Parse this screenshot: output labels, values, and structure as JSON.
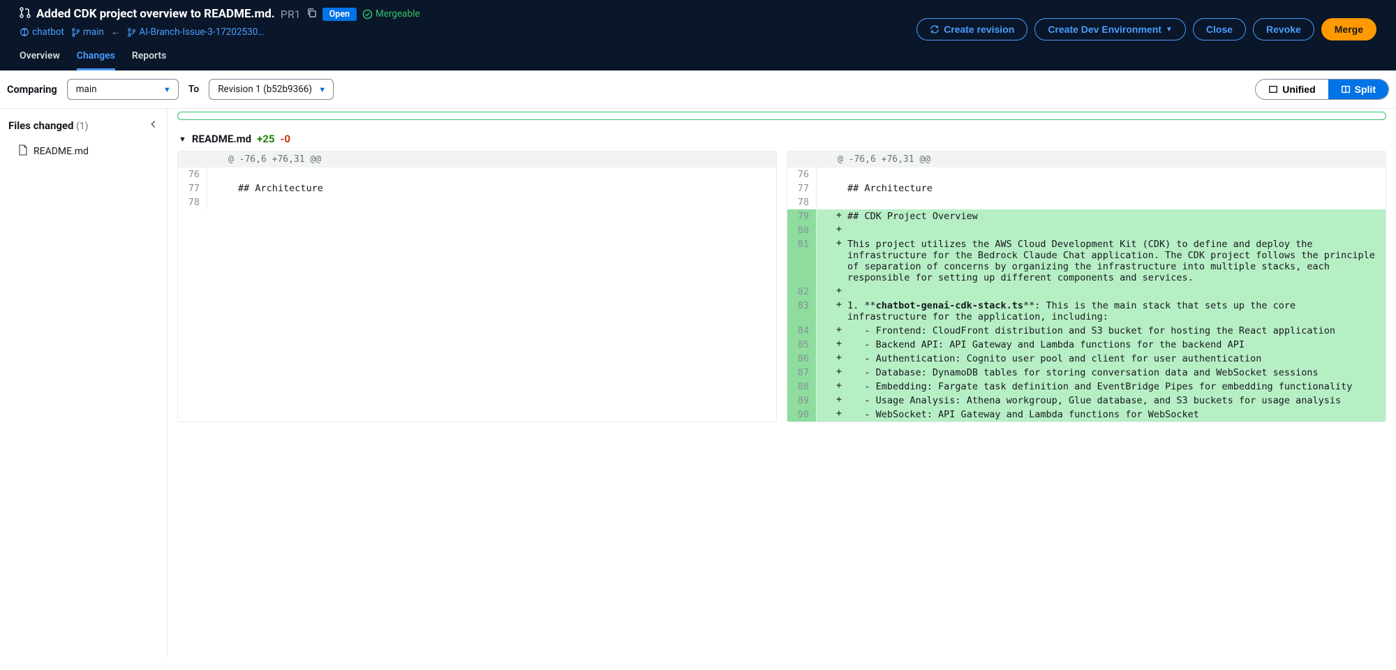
{
  "header": {
    "title": "Added CDK project overview to README.md.",
    "pr_number": "PR1",
    "status_badge": "Open",
    "mergeable_label": "Mergeable"
  },
  "breadcrumb": {
    "repo": "chatbot",
    "base_branch": "main",
    "source_branch": "AI-Branch-Issue-3-17202530…"
  },
  "actions": {
    "create_revision": "Create revision",
    "create_dev_env": "Create Dev Environment",
    "close": "Close",
    "revoke": "Revoke",
    "merge": "Merge"
  },
  "tabs": {
    "overview": "Overview",
    "changes": "Changes",
    "reports": "Reports"
  },
  "compare": {
    "label_comparing": "Comparing",
    "from_value": "main",
    "label_to": "To",
    "to_value": "Revision 1 (b52b9366)",
    "unified": "Unified",
    "split": "Split"
  },
  "sidebar": {
    "title": "Files changed",
    "count": "(1)",
    "file": "README.md"
  },
  "file_header": {
    "name": "README.md",
    "additions": "+25",
    "deletions": "-0"
  },
  "diff": {
    "hunk": "@ -76,6 +76,31 @@",
    "left_lines": [
      {
        "num": "76",
        "text": ""
      },
      {
        "num": "77",
        "text": "## Architecture"
      },
      {
        "num": "78",
        "text": ""
      }
    ],
    "right_context": [
      {
        "num": "76",
        "text": ""
      },
      {
        "num": "77",
        "text": "## Architecture"
      },
      {
        "num": "78",
        "text": ""
      }
    ],
    "right_added": [
      {
        "num": "79",
        "text": "## CDK Project Overview"
      },
      {
        "num": "80",
        "text": ""
      },
      {
        "num": "81",
        "text": "This project utilizes the AWS Cloud Development Kit (CDK) to define and deploy the infrastructure for the Bedrock Claude Chat application. The CDK project follows the principle of separation of concerns by organizing the infrastructure into multiple stacks, each responsible for setting up different components and services."
      },
      {
        "num": "82",
        "text": ""
      },
      {
        "num": "83",
        "bold_part": "chatbot-genai-cdk-stack.ts",
        "prefix": "1. **",
        "suffix": "**: This is the main stack that sets up the core infrastructure for the application, including:"
      },
      {
        "num": "84",
        "text": "   - Frontend: CloudFront distribution and S3 bucket for hosting the React application"
      },
      {
        "num": "85",
        "text": "   - Backend API: API Gateway and Lambda functions for the backend API"
      },
      {
        "num": "86",
        "text": "   - Authentication: Cognito user pool and client for user authentication"
      },
      {
        "num": "87",
        "text": "   - Database: DynamoDB tables for storing conversation data and WebSocket sessions"
      },
      {
        "num": "88",
        "text": "   - Embedding: Fargate task definition and EventBridge Pipes for embedding functionality"
      },
      {
        "num": "89",
        "text": "   - Usage Analysis: Athena workgroup, Glue database, and S3 buckets for usage analysis"
      },
      {
        "num": "90",
        "text": "   - WebSocket: API Gateway and Lambda functions for WebSocket"
      }
    ]
  }
}
